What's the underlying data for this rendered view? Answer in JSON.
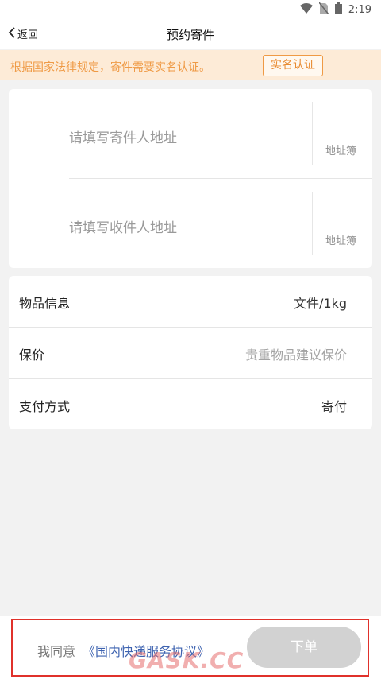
{
  "status_bar": {
    "time": "2:19",
    "icons": [
      "wifi-icon",
      "no-sim-icon",
      "battery-icon"
    ]
  },
  "nav": {
    "back_label": "返回",
    "title": "预约寄件"
  },
  "notice": {
    "text": "根据国家法律规定，寄件需要实名认证。",
    "button_label": "实名认证",
    "color": "#ef9a45"
  },
  "address": {
    "sender_placeholder": "请填写寄件人地址",
    "receiver_placeholder": "请填写收件人地址",
    "address_book_label": "地址簿"
  },
  "info": {
    "item_label": "物品信息",
    "item_value": "文件/1kg",
    "insure_label": "保价",
    "insure_placeholder": "贵重物品建议保价",
    "payment_label": "支付方式",
    "payment_value": "寄付"
  },
  "footer": {
    "agree_text": "我同意",
    "agreement_link": "《国内快递服务协议》",
    "order_label": "下单",
    "link_color": "#3e63b0"
  },
  "watermark": "GASK.CC"
}
